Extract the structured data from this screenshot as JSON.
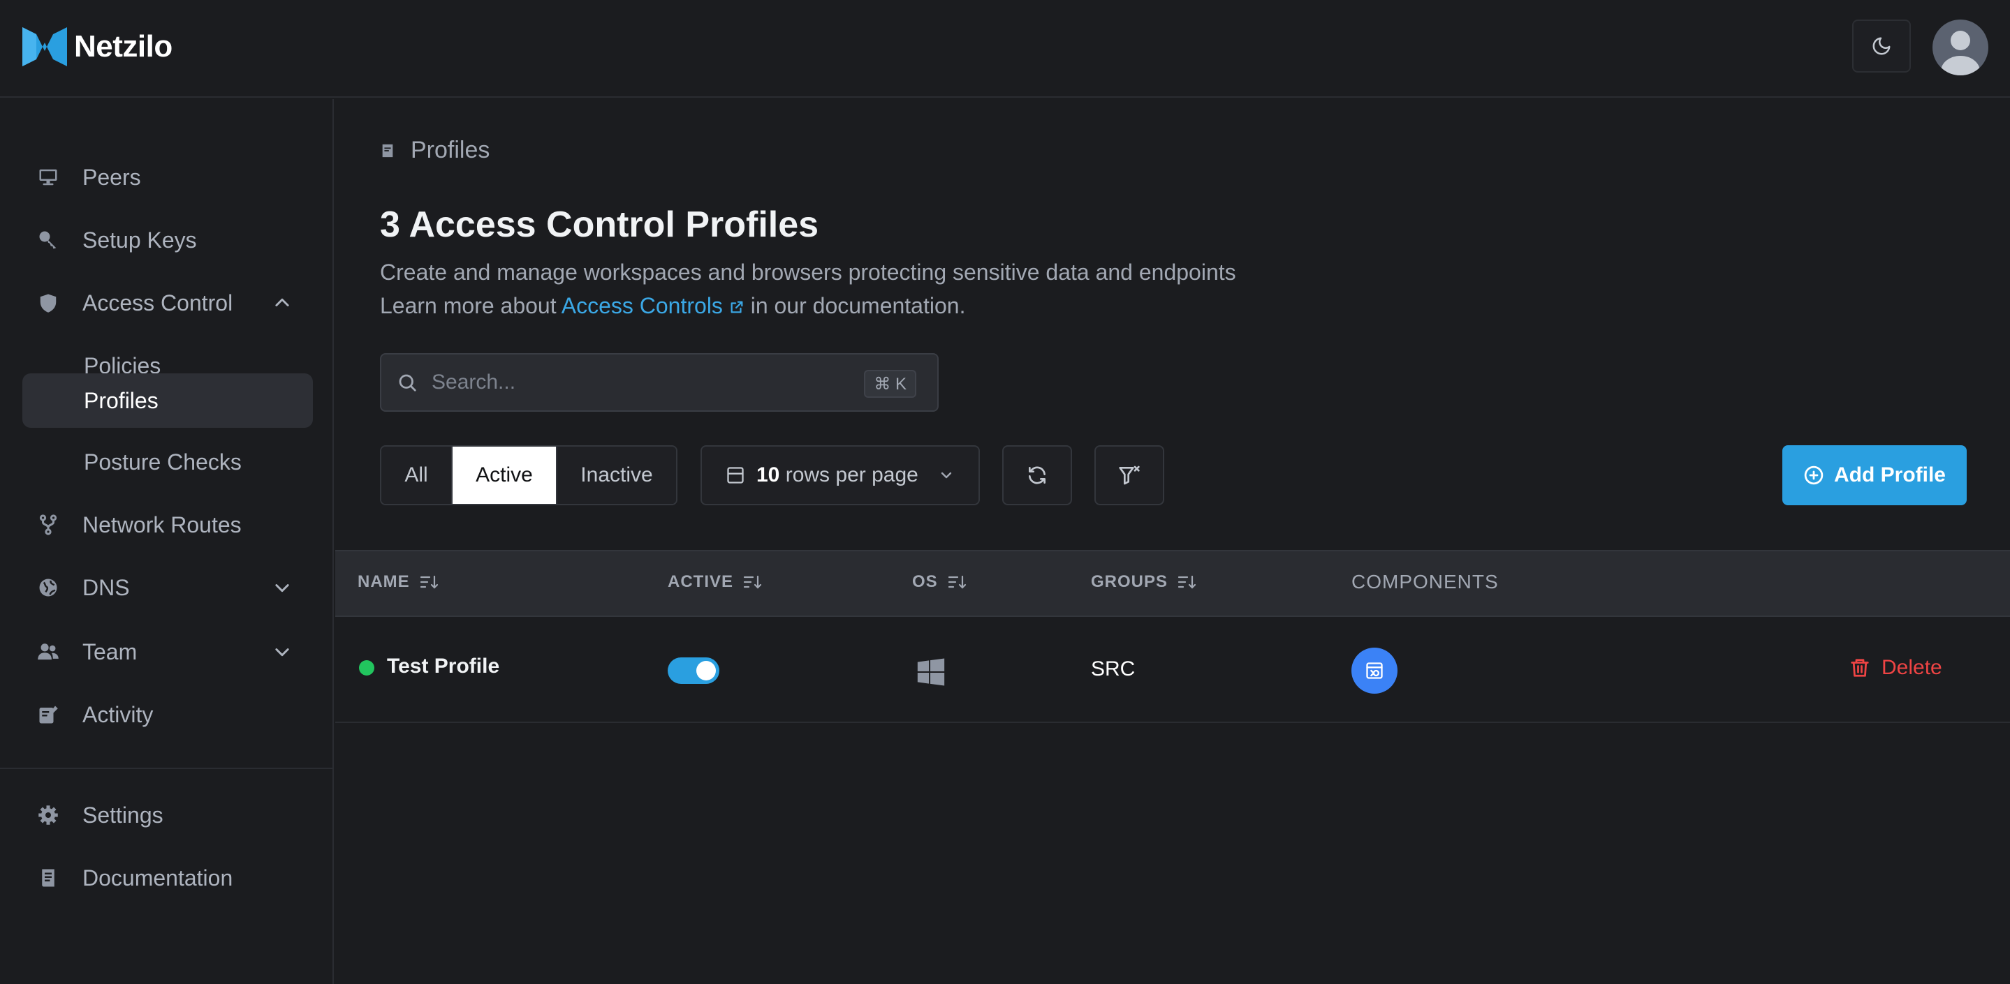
{
  "app": {
    "name": "Netzilo"
  },
  "sidebar": {
    "items": [
      {
        "label": "Peers",
        "icon": "monitor-icon"
      },
      {
        "label": "Setup Keys",
        "icon": "key-icon"
      },
      {
        "label": "Access Control",
        "icon": "shield-icon",
        "expanded": true,
        "children": [
          {
            "label": "Policies"
          },
          {
            "label": "Profiles",
            "active": true
          },
          {
            "label": "Posture Checks"
          }
        ]
      },
      {
        "label": "Network Routes",
        "icon": "branch-icon"
      },
      {
        "label": "DNS",
        "icon": "globe-icon",
        "expanded": false
      },
      {
        "label": "Team",
        "icon": "users-icon",
        "expanded": false
      },
      {
        "label": "Activity",
        "icon": "activity-icon"
      }
    ],
    "footer": [
      {
        "label": "Settings",
        "icon": "gear-icon"
      },
      {
        "label": "Documentation",
        "icon": "book-icon"
      }
    ]
  },
  "breadcrumb": {
    "label": "Profiles"
  },
  "page": {
    "title": "3 Access Control Profiles",
    "description": "Create and manage workspaces and browsers protecting sensitive data and endpoints",
    "learn_prefix": "Learn more about",
    "learn_link": "Access Controls",
    "learn_suffix": "in our documentation."
  },
  "search": {
    "placeholder": "Search...",
    "shortcut": "⌘ K"
  },
  "filters": {
    "tabs": [
      "All",
      "Active",
      "Inactive"
    ],
    "selected": "Active"
  },
  "pagination": {
    "rows_value": "10",
    "rows_label": "rows per page"
  },
  "actions": {
    "add_label": "Add Profile"
  },
  "table": {
    "columns": [
      "NAME",
      "ACTIVE",
      "OS",
      "GROUPS",
      "COMPONENTS"
    ],
    "rows": [
      {
        "name": "Test Profile",
        "active": true,
        "os": "windows-icon",
        "groups": "SRC",
        "component": "browser-icon",
        "delete_label": "Delete"
      }
    ]
  },
  "colors": {
    "accent": "#2a9fe0",
    "danger": "#ef4444",
    "status_active": "#22c55e"
  }
}
